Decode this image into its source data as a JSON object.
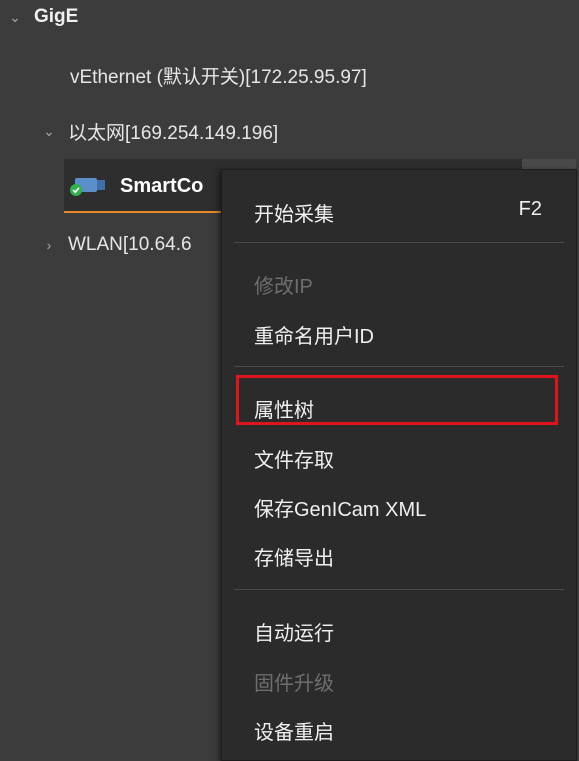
{
  "tree": {
    "root_label": "GigE",
    "items": [
      {
        "label": "vEthernet (默认开关)[172.25.95.97]"
      },
      {
        "label": "以太网[169.254.149.196]"
      },
      {
        "label": "WLAN[10.64.6"
      }
    ],
    "device": {
      "label": "SmartCo"
    }
  },
  "context_menu": {
    "items": [
      {
        "label": "开始采集",
        "shortcut": "F2",
        "enabled": true
      },
      {
        "label": "修改IP",
        "enabled": false
      },
      {
        "label": "重命名用户ID",
        "enabled": true
      },
      {
        "label": "属性树",
        "enabled": true,
        "highlighted": true
      },
      {
        "label": "文件存取",
        "enabled": true
      },
      {
        "label": "保存GenICam XML",
        "enabled": true
      },
      {
        "label": "存储导出",
        "enabled": true
      },
      {
        "label": "自动运行",
        "enabled": true
      },
      {
        "label": "固件升级",
        "enabled": false
      },
      {
        "label": "设备重启",
        "enabled": true
      }
    ]
  },
  "colors": {
    "background": "#3c3c3d",
    "menu_background": "#2b2b2c",
    "selection_underline": "#e88a2c",
    "highlight_box": "#e0151b",
    "status_green": "#2fb34a",
    "camera_blue": "#5b8fc9"
  },
  "icons": {
    "expanded": "chevron-down-icon",
    "collapsed": "chevron-right-icon",
    "device": "camera-icon",
    "status": "check-circle-icon"
  }
}
